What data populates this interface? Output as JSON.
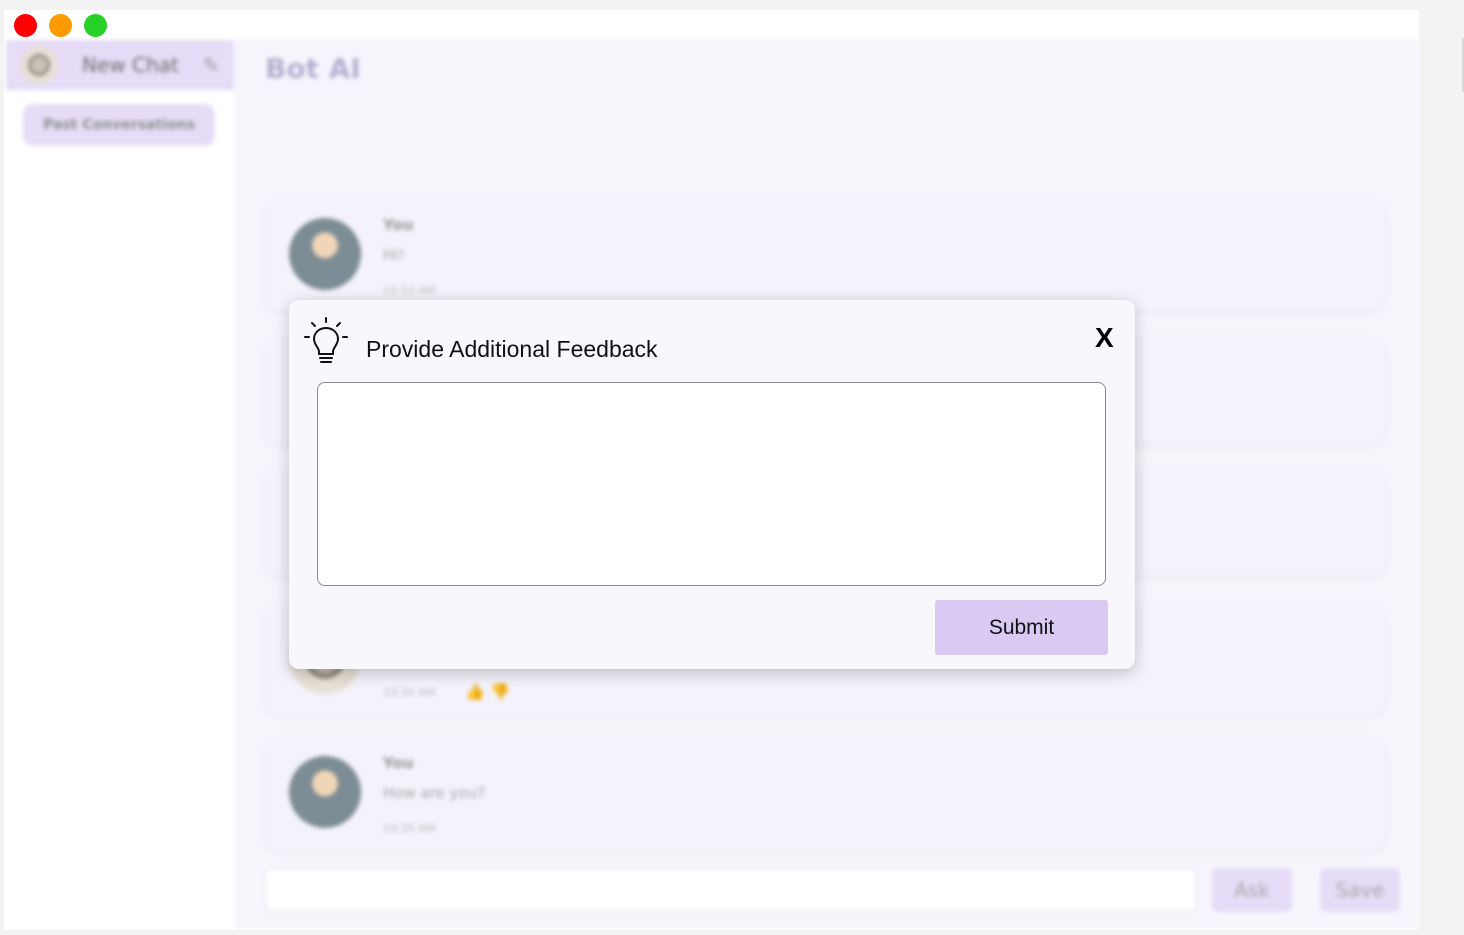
{
  "sidebar": {
    "new_chat_label": "New Chat",
    "past_conversations_label": "Past Conversations"
  },
  "main": {
    "title": "Bot AI",
    "messages": [
      {
        "author": "You",
        "text": "Hi!",
        "time": "10:33 AM"
      },
      {
        "author": "",
        "text": "",
        "time": ""
      },
      {
        "author": "",
        "text": "",
        "time": ""
      },
      {
        "author": "",
        "text": "",
        "time": "10:34 AM"
      },
      {
        "author": "You",
        "text": "How are you?",
        "time": "10:35 AM"
      }
    ],
    "ask_label": "Ask",
    "save_label": "Save"
  },
  "modal": {
    "title": "Provide Additional Feedback",
    "close_label": "X",
    "feedback_value": "",
    "submit_label": "Submit"
  },
  "colors": {
    "accent": "#d9c9f3",
    "traffic_red": "#ff0000",
    "traffic_orange": "#ff9a00",
    "traffic_green": "#27d127"
  },
  "icons": [
    "lightbulb-icon",
    "edit-icon",
    "thumbs-up-icon",
    "thumbs-down-icon"
  ]
}
